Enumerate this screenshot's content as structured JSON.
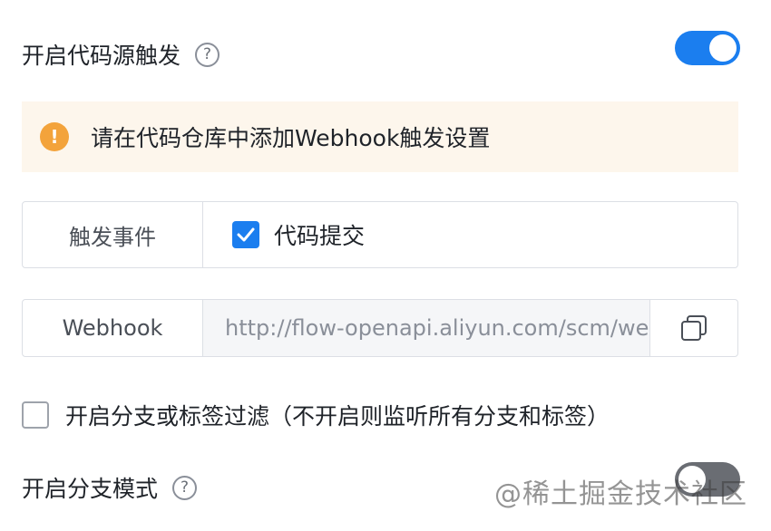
{
  "code_trigger": {
    "title": "开启代码源触发",
    "help_symbol": "?",
    "enabled": true
  },
  "alert": {
    "icon_symbol": "!",
    "text": "请在代码仓库中添加Webhook触发设置",
    "background": "#fdf6ec",
    "icon_color": "#f3a33b"
  },
  "trigger_event": {
    "label": "触发事件",
    "checkbox_checked": true,
    "option_label": "代码提交"
  },
  "webhook": {
    "label": "Webhook",
    "url": "http://flow-openapi.aliyun.com/scm/webhook",
    "copy_icon": "copy-icon"
  },
  "branch_filter": {
    "checked": false,
    "label": "开启分支或标签过滤（不开启则监听所有分支和标签）"
  },
  "branch_mode": {
    "title": "开启分支模式",
    "help_symbol": "?",
    "enabled": false
  },
  "watermark": {
    "text": "@稀土掘金技术社区"
  },
  "colors": {
    "accent": "#1b7eef",
    "switch_off": "#6a6d73",
    "border": "#dcdfe5"
  }
}
